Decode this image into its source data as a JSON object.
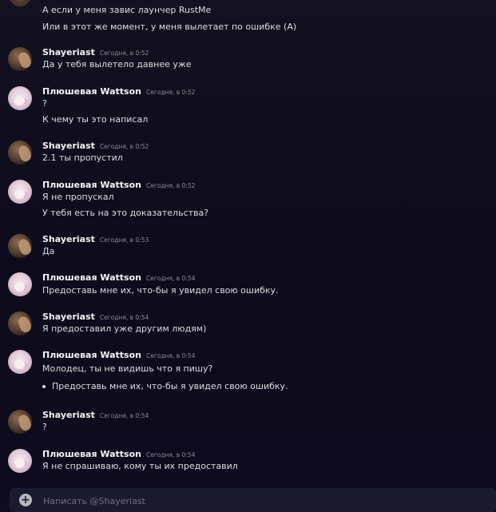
{
  "messages": {
    "top_lines": [
      "А если у меня завис лаунчер RustMe",
      "Или в этот же момент, у меня вылетает по ошибке (А)"
    ],
    "m1": {
      "author": "Shayeriast",
      "time": "Сегодня, в 0:52",
      "lines": [
        "Да у тебя вылетело давнее уже"
      ]
    },
    "m2": {
      "author": "Плюшевая Wattson",
      "time": "Сегодня, в 0:52",
      "lines": [
        "?",
        "К чему ты это написал"
      ]
    },
    "m3": {
      "author": "Shayeriast",
      "time": "Сегодня, в 0:52",
      "lines": [
        "2.1 ты пропустил"
      ]
    },
    "m4": {
      "author": "Плюшевая Wattson",
      "time": "Сегодня, в 0:52",
      "lines": [
        "Я не пропускал",
        "У тебя есть на это доказательства?"
      ]
    },
    "m5": {
      "author": "Shayeriast",
      "time": "Сегодня, в 0:53",
      "lines": [
        "Да"
      ]
    },
    "m6": {
      "author": "Плюшевая Wattson",
      "time": "Сегодня, в 0:54",
      "lines": [
        "Предоставь мне их, что-бы я увидел свою ошибку."
      ]
    },
    "m7": {
      "author": "Shayeriast",
      "time": "Сегодня, в 0:54",
      "lines": [
        "Я предоставил уже другим людям)"
      ]
    },
    "m8": {
      "author": "Плюшевая Wattson",
      "time": "Сегодня, в 0:54",
      "lines": [
        "Молодец, ты не видишь что я пишу?"
      ],
      "bullet": "Предоставь мне их, что-бы я увидел свою ошибку."
    },
    "m9": {
      "author": "Shayeriast",
      "time": "Сегодня, в 0:54",
      "lines": [
        "?"
      ]
    },
    "m10": {
      "author": "Плюшевая Wattson",
      "time": "Сегодня, в 0:54",
      "lines": [
        "Я не спрашиваю, кому ты их предоставил"
      ]
    }
  },
  "composer": {
    "placeholder": "Написать @Shayeriast",
    "plus_icon": "+"
  }
}
